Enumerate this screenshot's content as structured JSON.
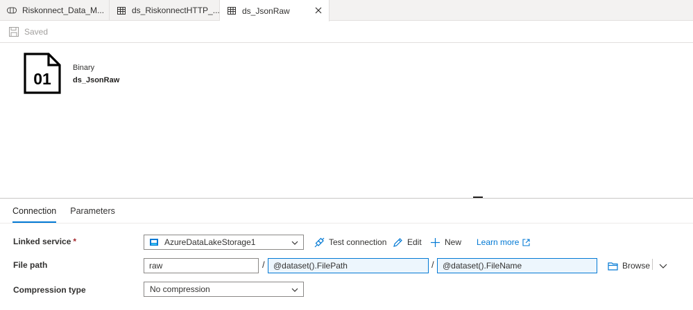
{
  "tabs": [
    {
      "label": "Riskonnect_Data_M...",
      "icon": "pipeline-icon",
      "active": false
    },
    {
      "label": "ds_RiskonnectHTTP_...",
      "icon": "table-icon",
      "active": false
    },
    {
      "label": "ds_JsonRaw",
      "icon": "table-icon",
      "active": true
    }
  ],
  "toolbar": {
    "saved_label": "Saved"
  },
  "dataset": {
    "icon_text": "01",
    "type": "Binary",
    "name": "ds_JsonRaw"
  },
  "panel_tabs": [
    {
      "label": "Connection",
      "active": true
    },
    {
      "label": "Parameters",
      "active": false
    }
  ],
  "form": {
    "linked_service": {
      "label": "Linked service",
      "required_mark": "*",
      "value": "AzureDataLakeStorage1",
      "test_connection": "Test connection",
      "edit": "Edit",
      "new": "New",
      "learn_more": "Learn more"
    },
    "file_path": {
      "label": "File path",
      "container": "raw",
      "separator": "/",
      "directory": "@dataset().FilePath",
      "file": "@dataset().FileName",
      "browse": "Browse"
    },
    "compression": {
      "label": "Compression type",
      "value": "No compression"
    }
  },
  "colors": {
    "accent": "#0078d4",
    "required": "#a4262c",
    "dynamic_bg": "#edf6fd"
  }
}
